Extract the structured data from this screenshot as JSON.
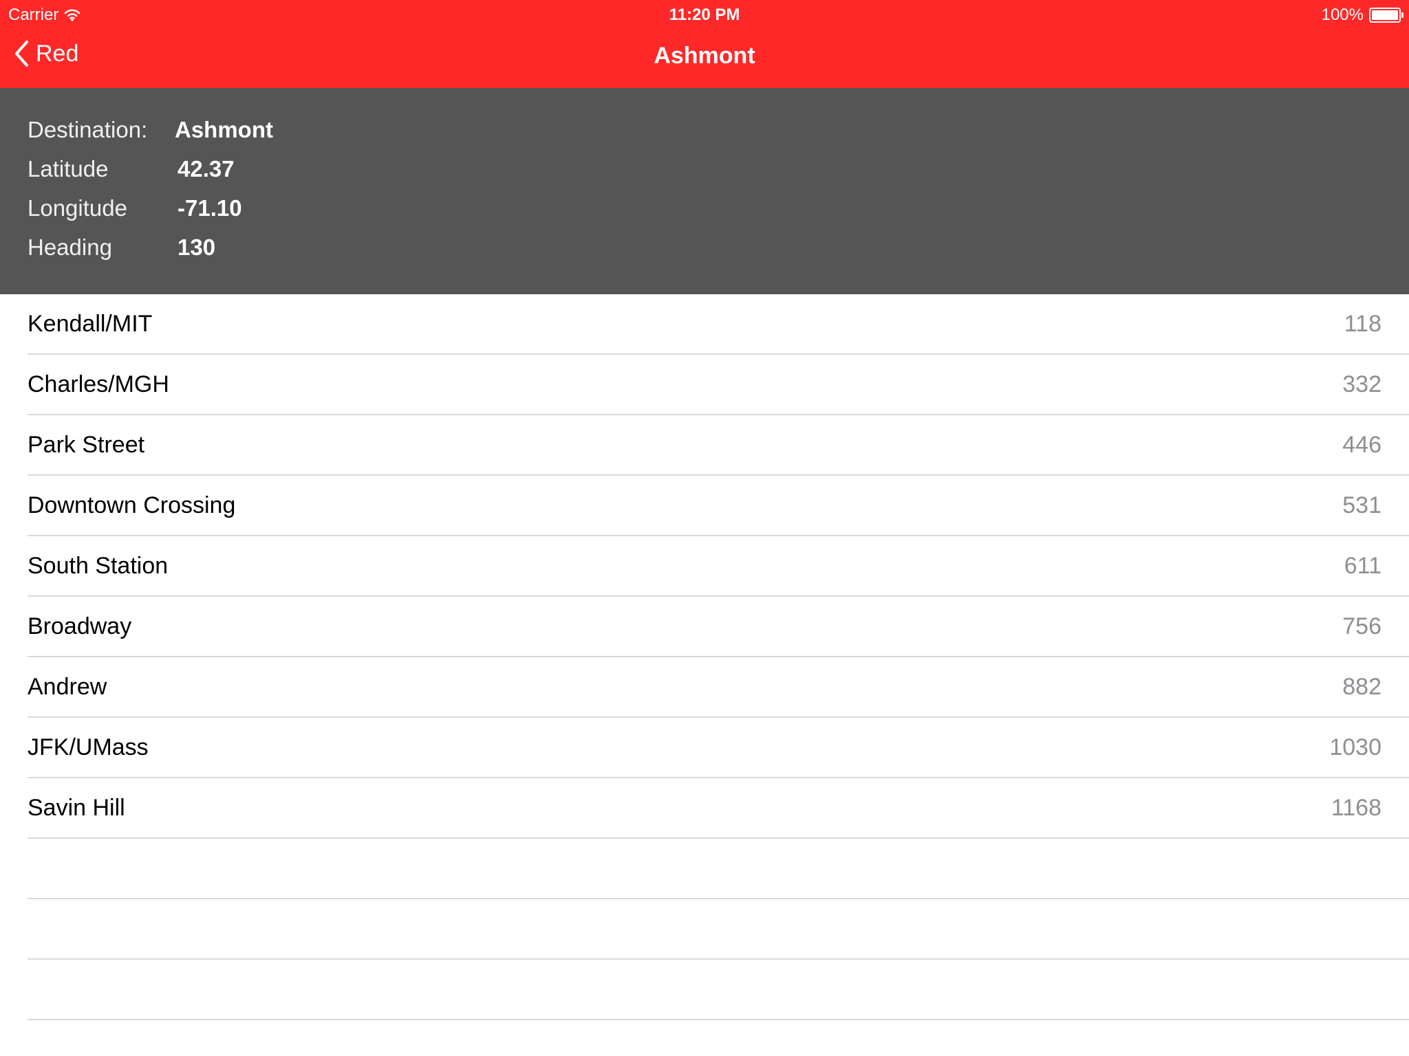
{
  "status_bar": {
    "carrier": "Carrier",
    "time": "11:20 PM",
    "battery": "100%"
  },
  "nav": {
    "back_label": "Red",
    "title": "Ashmont"
  },
  "info": {
    "destination_label": "Destination:",
    "destination_value": "Ashmont",
    "latitude_label": "Latitude",
    "latitude_value": "42.37",
    "longitude_label": "Longitude",
    "longitude_value": "-71.10",
    "heading_label": "Heading",
    "heading_value": "130"
  },
  "stops": [
    {
      "name": "Kendall/MIT",
      "value": "118"
    },
    {
      "name": "Charles/MGH",
      "value": "332"
    },
    {
      "name": "Park Street",
      "value": "446"
    },
    {
      "name": "Downtown Crossing",
      "value": "531"
    },
    {
      "name": "South Station",
      "value": "611"
    },
    {
      "name": "Broadway",
      "value": "756"
    },
    {
      "name": "Andrew",
      "value": "882"
    },
    {
      "name": "JFK/UMass",
      "value": "1030"
    },
    {
      "name": "Savin Hill",
      "value": "1168"
    }
  ],
  "colors": {
    "nav_red": "#ff2828",
    "panel_gray": "#555555",
    "separator": "#d9d9dd",
    "secondary_text": "#8e8e93"
  }
}
